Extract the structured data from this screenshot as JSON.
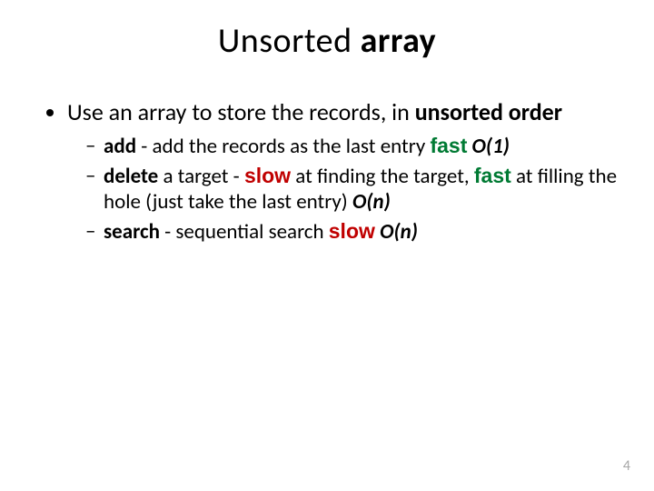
{
  "title": {
    "word1": "Unsorted ",
    "word2": "array"
  },
  "bullet_lead": "Use an array to store the records, in ",
  "bullet_bold": "unsorted order",
  "sub": {
    "add": {
      "label": "add",
      "text1": " - add the records as the last entry ",
      "fast": "fast",
      "tail": " O(1)"
    },
    "delete": {
      "label": "delete",
      "text1": " a target - ",
      "slow": "slow",
      "text2": " at finding the target, ",
      "fast": "fast",
      "text3": " at filling the hole (just take the last entry) ",
      "tail": "O(n)"
    },
    "search": {
      "label": "search",
      "text1": " - sequential search ",
      "slow": "slow",
      "tail": " O(n)"
    }
  },
  "page_number": "4"
}
